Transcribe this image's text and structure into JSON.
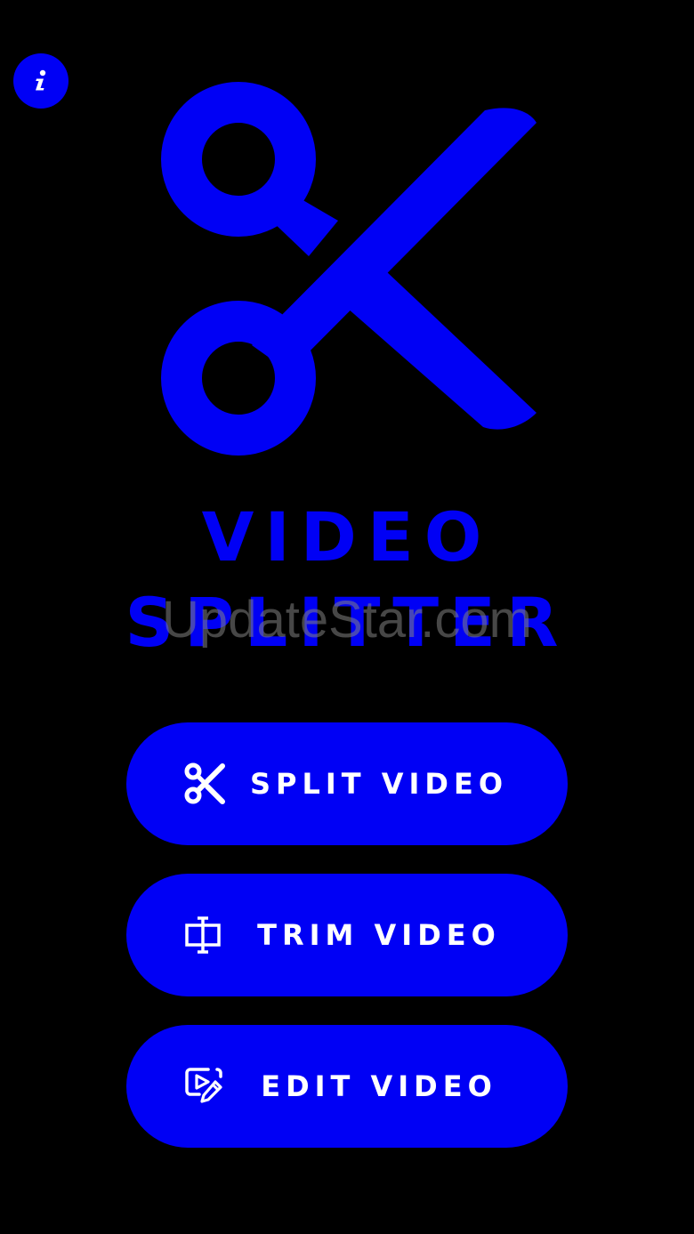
{
  "app": {
    "title_line_1": "VIDEO",
    "title_line_2": "SPLITTER"
  },
  "watermark": "UpdateStar.com",
  "buttons": {
    "split": {
      "label": "SPLIT VIDEO",
      "icon": "scissors-icon"
    },
    "trim": {
      "label": "TRIM VIDEO",
      "icon": "trim-icon"
    },
    "edit": {
      "label": "EDIT VIDEO",
      "icon": "edit-video-icon"
    }
  },
  "info": {
    "icon": "info-icon"
  },
  "colors": {
    "background": "#000000",
    "accent": "#0000F5",
    "button_text": "#FFFFFF"
  }
}
